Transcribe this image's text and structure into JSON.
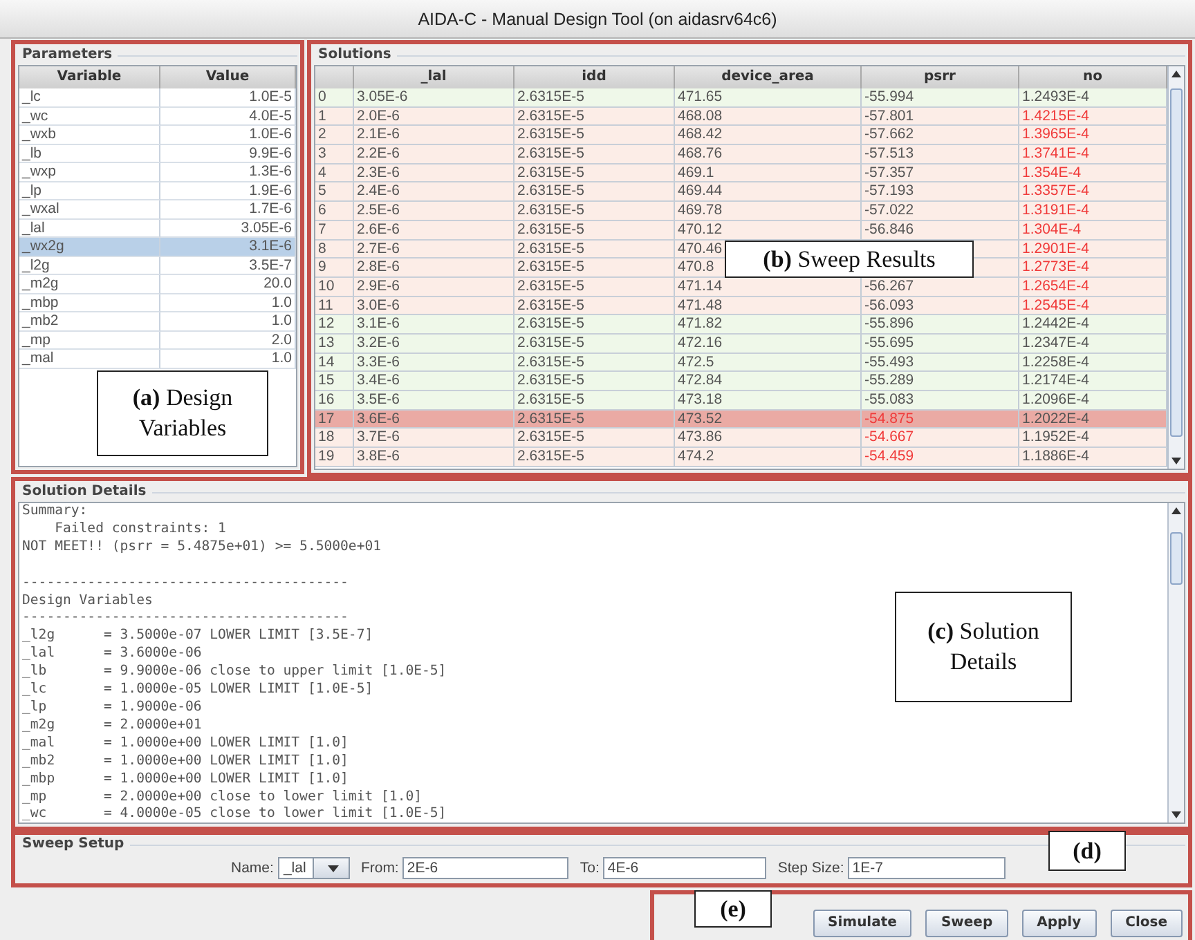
{
  "window": {
    "title": "AIDA-C - Manual Design Tool (on aidasrv64c6)"
  },
  "parameters": {
    "title": "Parameters",
    "columns": [
      "Variable",
      "Value"
    ],
    "rows": [
      {
        "variable": "_lc",
        "value": "1.0E-5",
        "selected": false
      },
      {
        "variable": "_wc",
        "value": "4.0E-5",
        "selected": false
      },
      {
        "variable": "_wxb",
        "value": "1.0E-6",
        "selected": false
      },
      {
        "variable": "_lb",
        "value": "9.9E-6",
        "selected": false
      },
      {
        "variable": "_wxp",
        "value": "1.3E-6",
        "selected": false
      },
      {
        "variable": "_lp",
        "value": "1.9E-6",
        "selected": false
      },
      {
        "variable": "_wxal",
        "value": "1.7E-6",
        "selected": false
      },
      {
        "variable": "_lal",
        "value": "3.05E-6",
        "selected": false
      },
      {
        "variable": "_wx2g",
        "value": "3.1E-6",
        "selected": true
      },
      {
        "variable": "_l2g",
        "value": "3.5E-7",
        "selected": false
      },
      {
        "variable": "_m2g",
        "value": "20.0",
        "selected": false
      },
      {
        "variable": "_mbp",
        "value": "1.0",
        "selected": false
      },
      {
        "variable": "_mb2",
        "value": "1.0",
        "selected": false
      },
      {
        "variable": "_mp",
        "value": "2.0",
        "selected": false
      },
      {
        "variable": "_mal",
        "value": "1.0",
        "selected": false
      }
    ]
  },
  "solutions": {
    "title": "Solutions",
    "columns": [
      "_lal",
      "idd",
      "device_area",
      "psrr",
      "no"
    ],
    "rows": [
      {
        "index": "0",
        "lal": "3.05E-6",
        "idd": "2.6315E-5",
        "device_area": "471.65",
        "psrr": {
          "text": "-55.994",
          "violated": false
        },
        "no": {
          "text": "1.2493E-4",
          "violated": false
        },
        "feasible": true,
        "selected": false
      },
      {
        "index": "1",
        "lal": "2.0E-6",
        "idd": "2.6315E-5",
        "device_area": "468.08",
        "psrr": {
          "text": "-57.801",
          "violated": false
        },
        "no": {
          "text": "1.4215E-4",
          "violated": true
        },
        "feasible": false,
        "selected": false
      },
      {
        "index": "2",
        "lal": "2.1E-6",
        "idd": "2.6315E-5",
        "device_area": "468.42",
        "psrr": {
          "text": "-57.662",
          "violated": false
        },
        "no": {
          "text": "1.3965E-4",
          "violated": true
        },
        "feasible": false,
        "selected": false
      },
      {
        "index": "3",
        "lal": "2.2E-6",
        "idd": "2.6315E-5",
        "device_area": "468.76",
        "psrr": {
          "text": "-57.513",
          "violated": false
        },
        "no": {
          "text": "1.3741E-4",
          "violated": true
        },
        "feasible": false,
        "selected": false
      },
      {
        "index": "4",
        "lal": "2.3E-6",
        "idd": "2.6315E-5",
        "device_area": "469.1",
        "psrr": {
          "text": "-57.357",
          "violated": false
        },
        "no": {
          "text": "1.354E-4",
          "violated": true
        },
        "feasible": false,
        "selected": false
      },
      {
        "index": "5",
        "lal": "2.4E-6",
        "idd": "2.6315E-5",
        "device_area": "469.44",
        "psrr": {
          "text": "-57.193",
          "violated": false
        },
        "no": {
          "text": "1.3357E-4",
          "violated": true
        },
        "feasible": false,
        "selected": false
      },
      {
        "index": "6",
        "lal": "2.5E-6",
        "idd": "2.6315E-5",
        "device_area": "469.78",
        "psrr": {
          "text": "-57.022",
          "violated": false
        },
        "no": {
          "text": "1.3191E-4",
          "violated": true
        },
        "feasible": false,
        "selected": false
      },
      {
        "index": "7",
        "lal": "2.6E-6",
        "idd": "2.6315E-5",
        "device_area": "470.12",
        "psrr": {
          "text": "-56.846",
          "violated": false
        },
        "no": {
          "text": "1.304E-4",
          "violated": true
        },
        "feasible": false,
        "selected": false
      },
      {
        "index": "8",
        "lal": "2.7E-6",
        "idd": "2.6315E-5",
        "device_area": "470.46",
        "no": {
          "text": "1.2901E-4",
          "violated": true
        },
        "feasible": false,
        "selected": false
      },
      {
        "index": "9",
        "lal": "2.8E-6",
        "idd": "2.6315E-5",
        "device_area": "470.8",
        "no": {
          "text": "1.2773E-4",
          "violated": true
        },
        "feasible": false,
        "selected": false
      },
      {
        "index": "10",
        "lal": "2.9E-6",
        "idd": "2.6315E-5",
        "device_area": "471.14",
        "psrr": {
          "text": "-56.267",
          "violated": false
        },
        "no": {
          "text": "1.2654E-4",
          "violated": true
        },
        "feasible": false,
        "selected": false
      },
      {
        "index": "11",
        "lal": "3.0E-6",
        "idd": "2.6315E-5",
        "device_area": "471.48",
        "psrr": {
          "text": "-56.093",
          "violated": false
        },
        "no": {
          "text": "1.2545E-4",
          "violated": true
        },
        "feasible": false,
        "selected": false
      },
      {
        "index": "12",
        "lal": "3.1E-6",
        "idd": "2.6315E-5",
        "device_area": "471.82",
        "psrr": {
          "text": "-55.896",
          "violated": false
        },
        "no": {
          "text": "1.2442E-4",
          "violated": false
        },
        "feasible": true,
        "selected": false
      },
      {
        "index": "13",
        "lal": "3.2E-6",
        "idd": "2.6315E-5",
        "device_area": "472.16",
        "psrr": {
          "text": "-55.695",
          "violated": false
        },
        "no": {
          "text": "1.2347E-4",
          "violated": false
        },
        "feasible": true,
        "selected": false
      },
      {
        "index": "14",
        "lal": "3.3E-6",
        "idd": "2.6315E-5",
        "device_area": "472.5",
        "psrr": {
          "text": "-55.493",
          "violated": false
        },
        "no": {
          "text": "1.2258E-4",
          "violated": false
        },
        "feasible": true,
        "selected": false
      },
      {
        "index": "15",
        "lal": "3.4E-6",
        "idd": "2.6315E-5",
        "device_area": "472.84",
        "psrr": {
          "text": "-55.289",
          "violated": false
        },
        "no": {
          "text": "1.2174E-4",
          "violated": false
        },
        "feasible": true,
        "selected": false
      },
      {
        "index": "16",
        "lal": "3.5E-6",
        "idd": "2.6315E-5",
        "device_area": "473.18",
        "psrr": {
          "text": "-55.083",
          "violated": false
        },
        "no": {
          "text": "1.2096E-4",
          "violated": false
        },
        "feasible": true,
        "selected": false
      },
      {
        "index": "17",
        "lal": "3.6E-6",
        "idd": "2.6315E-5",
        "device_area": "473.52",
        "psrr": {
          "text": "-54.875",
          "violated": true
        },
        "no": {
          "text": "1.2022E-4",
          "violated": false
        },
        "feasible": false,
        "selected": true
      },
      {
        "index": "18",
        "lal": "3.7E-6",
        "idd": "2.6315E-5",
        "device_area": "473.86",
        "psrr": {
          "text": "-54.667",
          "violated": true
        },
        "no": {
          "text": "1.1952E-4",
          "violated": false
        },
        "feasible": false,
        "selected": false
      },
      {
        "index": "19",
        "lal": "3.8E-6",
        "idd": "2.6315E-5",
        "device_area": "474.2",
        "psrr": {
          "text": "-54.459",
          "violated": true
        },
        "no": {
          "text": "1.1886E-4",
          "violated": false
        },
        "feasible": false,
        "selected": false
      }
    ]
  },
  "solution_details": {
    "title": "Solution Details",
    "text": "Summary:\n    Failed constraints: 1\nNOT MEET!! (psrr = 5.4875e+01) >= 5.5000e+01\n\n----------------------------------------\nDesign Variables\n----------------------------------------\n_l2g      = 3.5000e-07 LOWER LIMIT [3.5E-7]\n_lal      = 3.6000e-06\n_lb       = 9.9000e-06 close to upper limit [1.0E-5]\n_lc       = 1.0000e-05 LOWER LIMIT [1.0E-5]\n_lp       = 1.9000e-06\n_m2g      = 2.0000e+01\n_mal      = 1.0000e+00 LOWER LIMIT [1.0]\n_mb2      = 1.0000e+00 LOWER LIMIT [1.0]\n_mbp      = 1.0000e+00 LOWER LIMIT [1.0]\n_mp       = 2.0000e+00 close to lower limit [1.0]\n_wc       = 4.0000e-05 close to lower limit [1.0E-5]"
  },
  "sweep_setup": {
    "title": "Sweep Setup",
    "name": {
      "label": "Name:",
      "value": "_lal"
    },
    "fields": [
      {
        "label": "From:",
        "value": "2E-6"
      },
      {
        "label": "To:",
        "value": "4E-6"
      },
      {
        "label": "Step Size:",
        "value": "1E-7"
      }
    ]
  },
  "buttons": [
    "Simulate",
    "Sweep",
    "Apply",
    "Close"
  ],
  "annotations": [
    {
      "text": "**(a)** Design Variables"
    },
    {
      "text": "**(b)** Sweep Results"
    },
    {
      "text": "**(c)** Solution Details"
    },
    {
      "text": "**(d)**"
    },
    {
      "text": "**(e)**"
    }
  ]
}
